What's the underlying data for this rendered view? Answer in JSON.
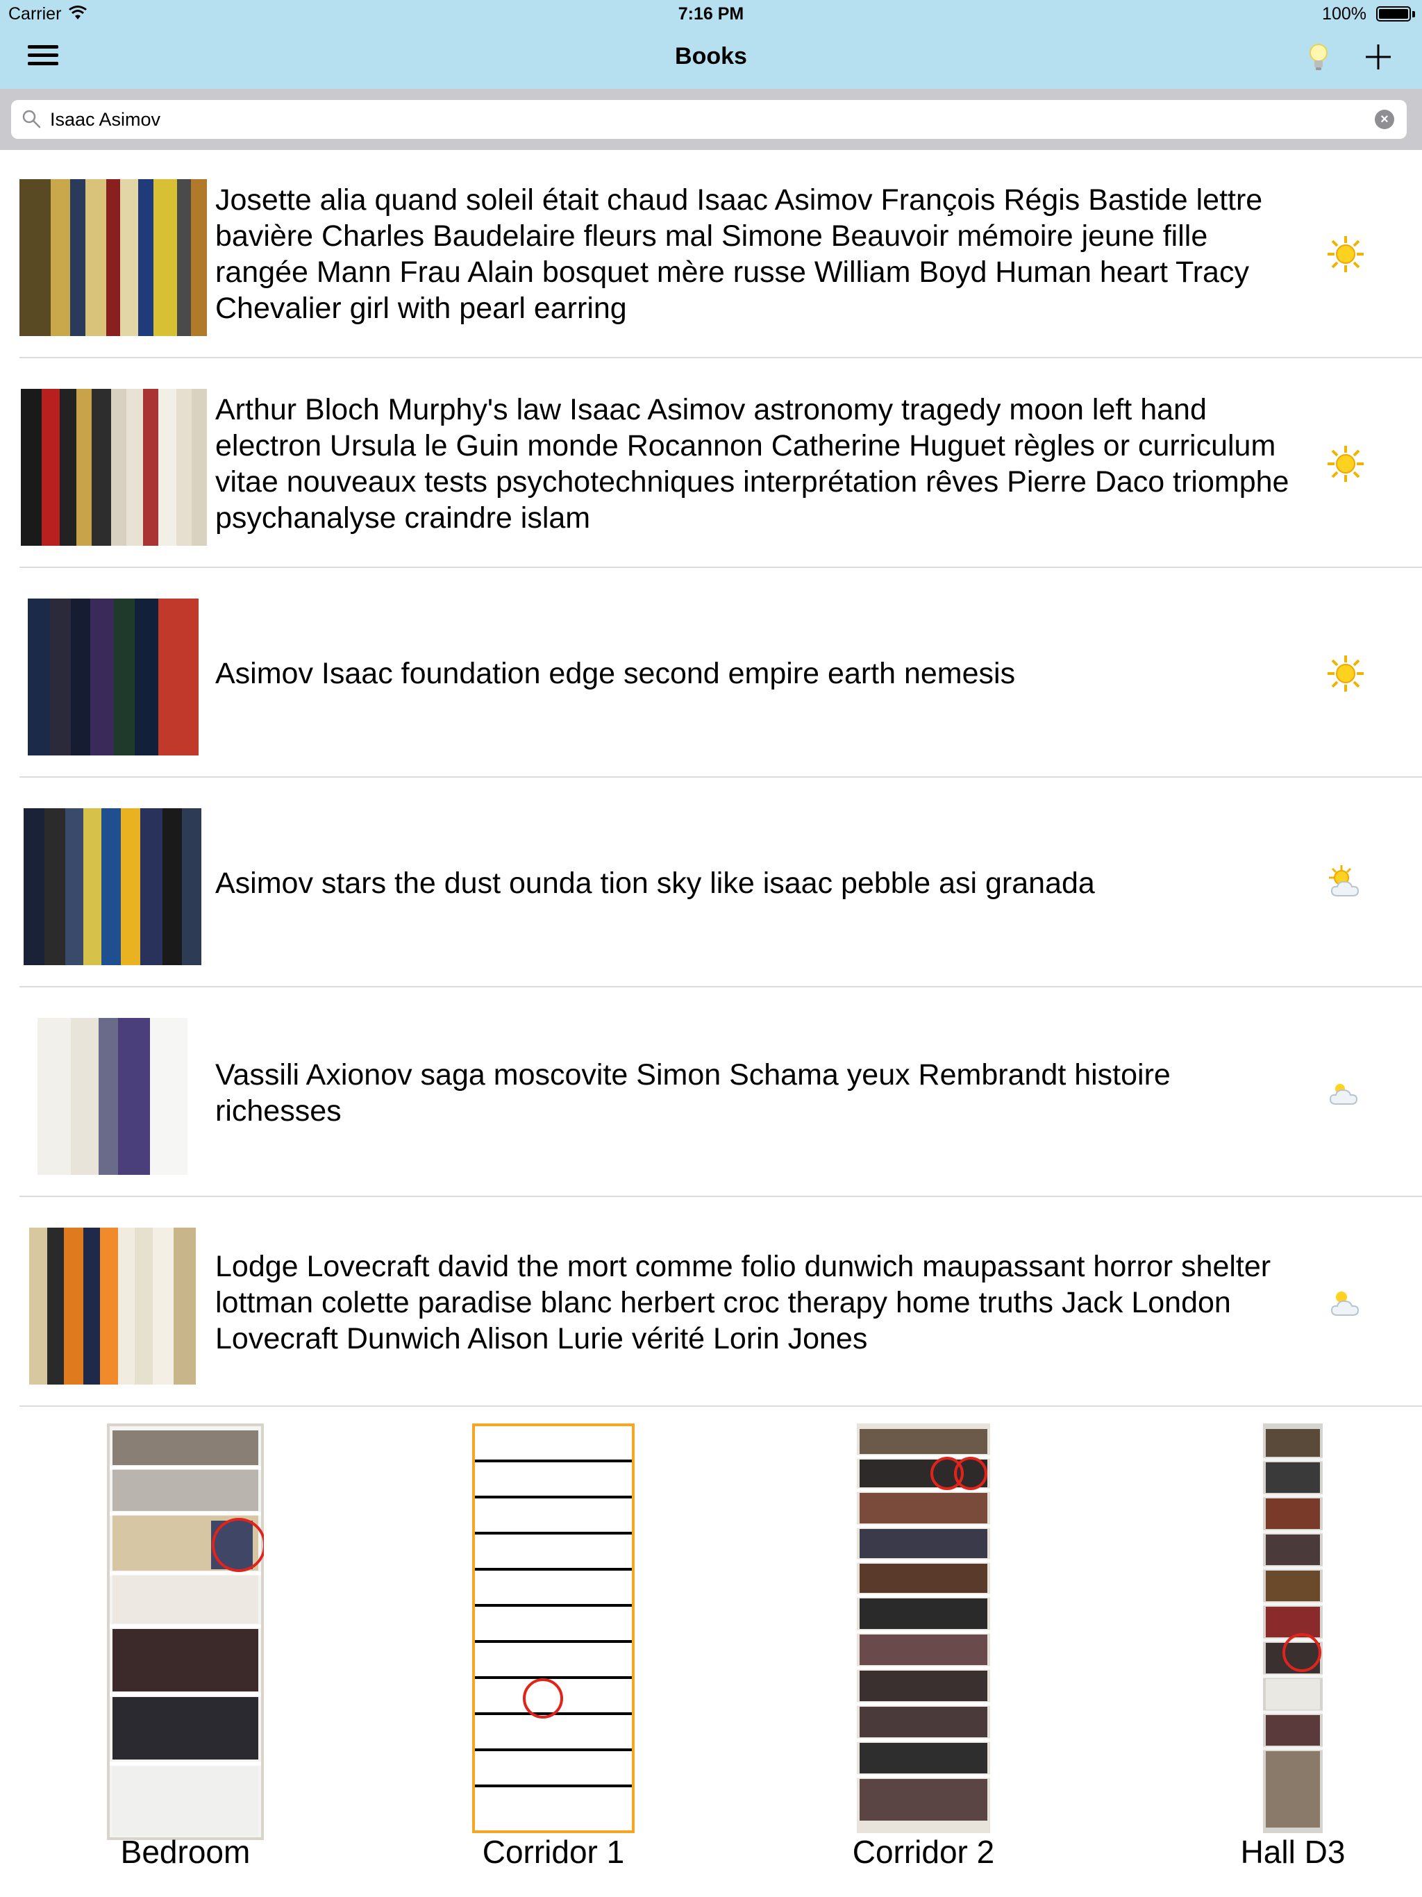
{
  "status": {
    "carrier": "Carrier",
    "time": "7:16 PM",
    "battery": "100%"
  },
  "nav": {
    "title": "Books"
  },
  "search": {
    "value": "Isaac Asimov"
  },
  "results": [
    {
      "text": "Josette alia quand soleil était chaud Isaac Asimov François Régis Bastide lettre bavière Charles Baudelaire fleurs mal Simone Beauvoir mémoire jeune fille rangée Mann Frau Alain bosquet mère russe William Boyd Human heart Tracy Chevalier girl with pearl earring",
      "weather": "sun-icon"
    },
    {
      "text": "Arthur Bloch Murphy's law Isaac Asimov astronomy tragedy moon left hand electron Ursula le Guin monde Rocannon Catherine Huguet règles or curriculum vitae nouveaux tests psychotechniques interprétation rêves Pierre Daco triomphe psychanalyse craindre islam",
      "weather": "sun-icon"
    },
    {
      "text": "Asimov Isaac foundation edge second empire earth nemesis",
      "weather": "sun-icon"
    },
    {
      "text": "Asimov stars the dust ounda tion sky like isaac pebble asi granada",
      "weather": "sun-cloud-icon"
    },
    {
      "text": "Vassili Axionov saga moscovite Simon Schama yeux Rembrandt histoire richesses",
      "weather": "cloud-icon"
    },
    {
      "text": "Lodge Lovecraft david the mort comme folio dunwich maupassant horror shelter lottman colette paradise blanc herbert croc therapy home truths Jack London Lovecraft Dunwich Alison Lurie vérité Lorin Jones",
      "weather": "sun-cloud-icon"
    }
  ],
  "shelves": [
    {
      "label": "Bedroom"
    },
    {
      "label": "Corridor 1"
    },
    {
      "label": "Corridor 2"
    },
    {
      "label": "Hall D3"
    }
  ],
  "colors": {
    "nav_bg": "#b6e0f0",
    "search_bar_bg": "#c9c9ce",
    "highlight_circle": "#e0241b",
    "selected_shelf_border": "#f5a623"
  }
}
